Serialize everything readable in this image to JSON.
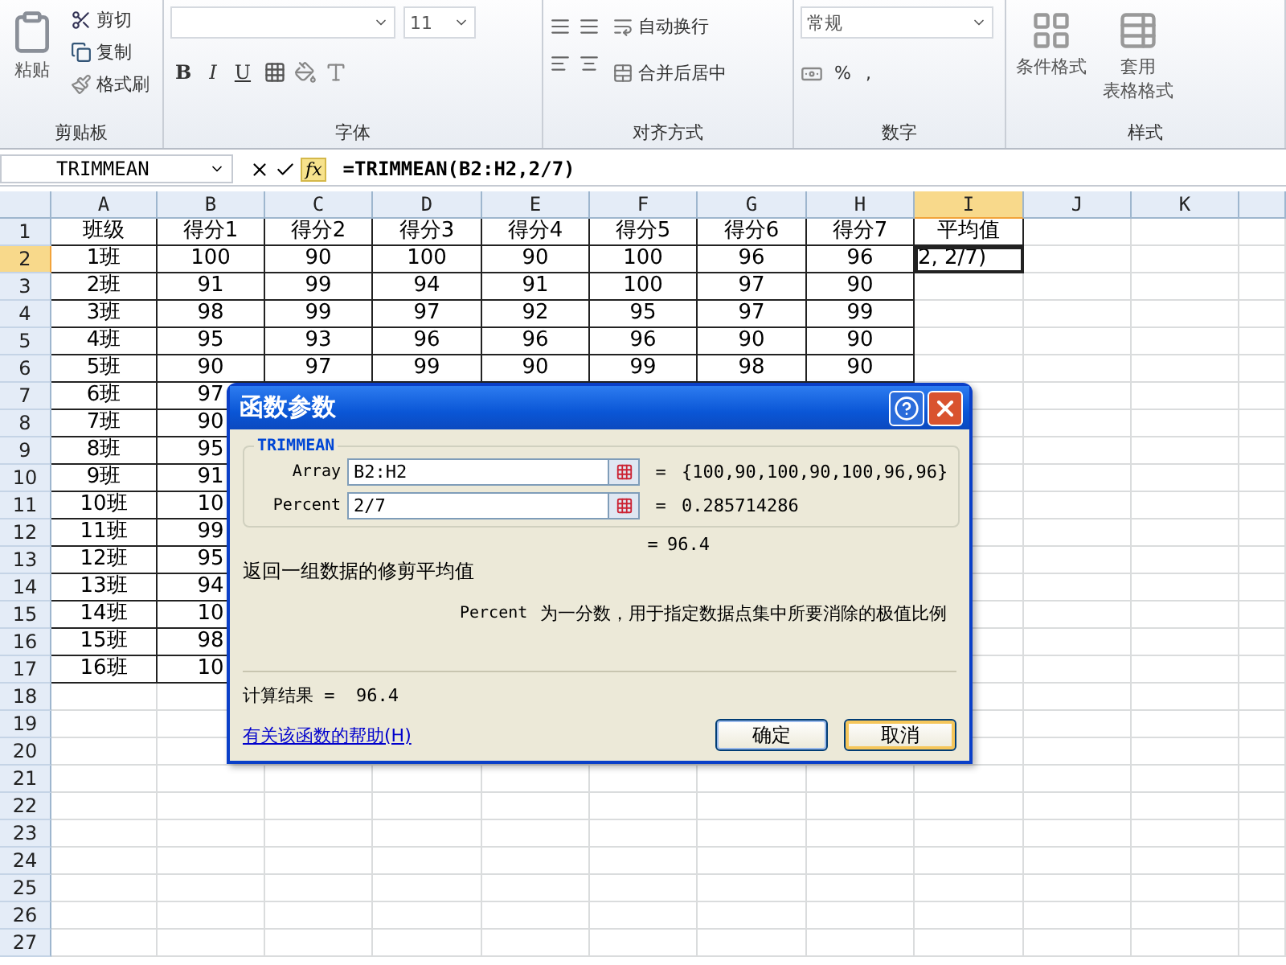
{
  "ribbon": {
    "clipboard": {
      "paste": "粘贴",
      "cut": "剪切",
      "copy": "复制",
      "format_painter": "格式刷",
      "label": "剪贴板"
    },
    "font": {
      "font_size": "11",
      "bold": "B",
      "italic": "I",
      "underline": "U",
      "label": "字体"
    },
    "alignment": {
      "wrap_text": "自动换行",
      "merge_center": "合并后居中",
      "label": "对齐方式"
    },
    "number": {
      "format": "常规",
      "percent": "%",
      "comma": ",",
      "label": "数字"
    },
    "styles": {
      "conditional": "条件格式",
      "table_format": [
        "套用",
        "表格格式"
      ],
      "label": "样式"
    }
  },
  "formula_bar": {
    "name_box": "TRIMMEAN",
    "fx": "fx",
    "formula": "=TRIMMEAN(B2:H2,2/7)"
  },
  "sheet": {
    "columns": [
      {
        "label": "A",
        "selected": false
      },
      {
        "label": "B",
        "selected": false
      },
      {
        "label": "C",
        "selected": false
      },
      {
        "label": "D",
        "selected": false
      },
      {
        "label": "E",
        "selected": false
      },
      {
        "label": "F",
        "selected": false
      },
      {
        "label": "G",
        "selected": false
      },
      {
        "label": "H",
        "selected": false
      },
      {
        "label": "I",
        "selected": true
      },
      {
        "label": "J",
        "selected": false
      },
      {
        "label": "K",
        "selected": false
      }
    ],
    "rows": [
      {
        "header": "1",
        "selected": false,
        "cells": [
          "班级",
          "得分1",
          "得分2",
          "得分3",
          "得分4",
          "得分5",
          "得分6",
          "得分7",
          "平均值"
        ]
      },
      {
        "header": "2",
        "selected": true,
        "cells": [
          "1班",
          "100",
          "90",
          "100",
          "90",
          "100",
          "96",
          "96",
          "2, 2/7)"
        ]
      },
      {
        "header": "3",
        "selected": false,
        "cells": [
          "2班",
          "91",
          "99",
          "94",
          "91",
          "100",
          "97",
          "90"
        ]
      },
      {
        "header": "4",
        "selected": false,
        "cells": [
          "3班",
          "98",
          "99",
          "97",
          "92",
          "95",
          "97",
          "99"
        ]
      },
      {
        "header": "5",
        "selected": false,
        "cells": [
          "4班",
          "95",
          "93",
          "96",
          "96",
          "96",
          "90",
          "90"
        ]
      },
      {
        "header": "6",
        "selected": false,
        "cells": [
          "5班",
          "90",
          "97",
          "99",
          "90",
          "99",
          "98",
          "90"
        ]
      },
      {
        "header": "7",
        "selected": false,
        "cells": [
          "6班",
          "97"
        ]
      },
      {
        "header": "8",
        "selected": false,
        "cells": [
          "7班",
          "90"
        ]
      },
      {
        "header": "9",
        "selected": false,
        "cells": [
          "8班",
          "95"
        ]
      },
      {
        "header": "10",
        "selected": false,
        "cells": [
          "9班",
          "91"
        ]
      },
      {
        "header": "11",
        "selected": false,
        "cells": [
          "10班",
          "10"
        ]
      },
      {
        "header": "12",
        "selected": false,
        "cells": [
          "11班",
          "99"
        ]
      },
      {
        "header": "13",
        "selected": false,
        "cells": [
          "12班",
          "95"
        ]
      },
      {
        "header": "14",
        "selected": false,
        "cells": [
          "13班",
          "94"
        ]
      },
      {
        "header": "15",
        "selected": false,
        "cells": [
          "14班",
          "10"
        ]
      },
      {
        "header": "16",
        "selected": false,
        "cells": [
          "15班",
          "98"
        ]
      },
      {
        "header": "17",
        "selected": false,
        "cells": [
          "16班",
          "10"
        ]
      },
      {
        "header": "18",
        "selected": false,
        "cells": []
      },
      {
        "header": "19",
        "selected": false,
        "cells": []
      },
      {
        "header": "20",
        "selected": false,
        "cells": []
      },
      {
        "header": "21",
        "selected": false,
        "cells": []
      },
      {
        "header": "22",
        "selected": false,
        "cells": []
      },
      {
        "header": "23",
        "selected": false,
        "cells": []
      },
      {
        "header": "24",
        "selected": false,
        "cells": []
      },
      {
        "header": "25",
        "selected": false,
        "cells": []
      },
      {
        "header": "26",
        "selected": false,
        "cells": []
      },
      {
        "header": "27",
        "selected": false,
        "cells": []
      }
    ]
  },
  "dialog": {
    "title": "函数参数",
    "function_name": "TRIMMEAN",
    "arguments": [
      {
        "name": "Array",
        "value": "B2:H2",
        "equals": "=",
        "result": "{100,90,100,90,100,96,96}"
      },
      {
        "name": "Percent",
        "value": "2/7",
        "equals": "=",
        "result": "0.285714286"
      }
    ],
    "formula_equals": "=",
    "formula_result": "96.4",
    "description": "返回一组数据的修剪平均值",
    "argument_help": {
      "name": "Percent",
      "text": "为一分数，用于指定数据点集中所要消除的极值比例"
    },
    "result_line": "计算结果 =  96.4",
    "help_link": "有关该函数的帮助(H)",
    "buttons": [
      "确定",
      "取消"
    ]
  }
}
